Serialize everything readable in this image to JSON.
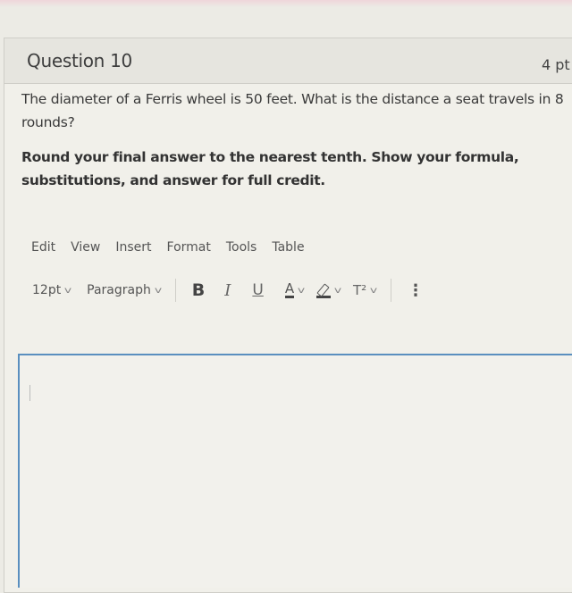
{
  "question": {
    "title": "Question 10",
    "points": "4 pt",
    "text": "The diameter of a Ferris wheel is 50 feet. What is the distance a seat travels in 8 rounds?",
    "instructions": "Round your final answer to the nearest tenth. Show your formula, substitutions, and answer for full credit."
  },
  "editor": {
    "menu": [
      "Edit",
      "View",
      "Insert",
      "Format",
      "Tools",
      "Table"
    ],
    "font_size": "12pt",
    "block_format": "Paragraph",
    "buttons": {
      "bold": "B",
      "italic": "I",
      "underline": "U",
      "text_color": "A",
      "superscript": "T²",
      "more": "⋮"
    },
    "content": "",
    "colors": {
      "focus_border": "#5a8fbf"
    }
  }
}
